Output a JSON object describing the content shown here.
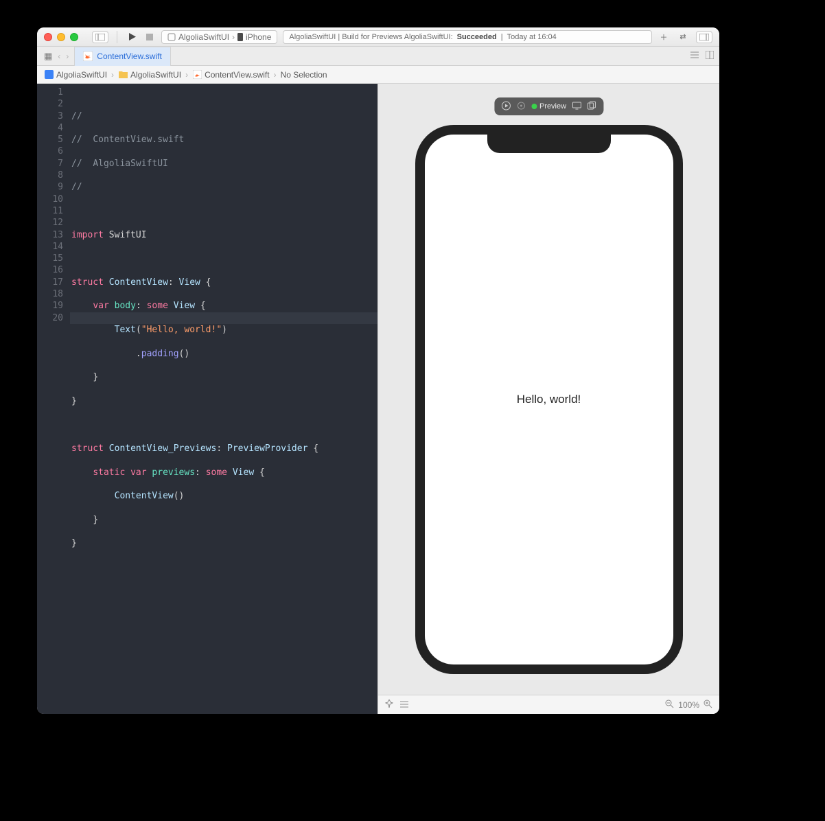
{
  "toolbar": {
    "scheme_target": "AlgoliaSwiftUI",
    "scheme_destination": "iPhone",
    "status_prefix": "AlgoliaSwiftUI | Build for Previews AlgoliaSwiftUI:",
    "status_result": "Succeeded",
    "status_time": "Today at 16:04"
  },
  "tab": {
    "filename": "ContentView.swift"
  },
  "breadcrumb": {
    "project": "AlgoliaSwiftUI",
    "folder": "AlgoliaSwiftUI",
    "file": "ContentView.swift",
    "selection": "No Selection"
  },
  "gutter": [
    "1",
    "2",
    "3",
    "4",
    "5",
    "6",
    "7",
    "8",
    "9",
    "10",
    "11",
    "12",
    "13",
    "14",
    "15",
    "16",
    "17",
    "18",
    "19",
    "20"
  ],
  "code": {
    "l1": "//",
    "l2a": "//  ",
    "l2b": "ContentView.swift",
    "l3a": "//  ",
    "l3b": "AlgoliaSwiftUI",
    "l4": "//",
    "imp": "import",
    "swiftui": "SwiftUI",
    "struct": "struct",
    "contentview": "ContentView",
    "view": "View",
    "var": "var",
    "body": "body",
    "some": "some",
    "text": "Text",
    "hello": "\"Hello, world!\"",
    "padding": "padding",
    "previews_struct": "ContentView_Previews",
    "previewprovider": "PreviewProvider",
    "static": "static",
    "previews": "previews",
    "cv_call": "ContentView"
  },
  "preview": {
    "pill_label": "Preview",
    "phone_text": "Hello, world!",
    "zoom": "100%"
  }
}
